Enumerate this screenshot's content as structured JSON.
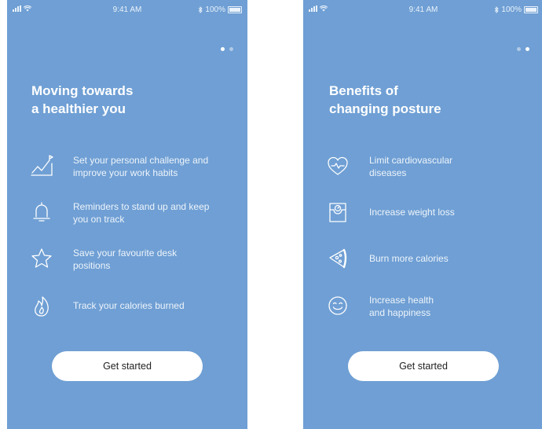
{
  "screens": [
    {
      "status": {
        "time": "9:41 AM",
        "battery": "100%"
      },
      "title_lines": [
        "Moving towards",
        "a healthier you"
      ],
      "features": [
        {
          "icon": "chart-trend-icon",
          "lines": [
            "Set your personal challenge and",
            "improve your work habits"
          ]
        },
        {
          "icon": "bell-icon",
          "lines": [
            "Reminders to stand up and keep",
            "you on track"
          ]
        },
        {
          "icon": "star-icon",
          "lines": [
            "Save your favourite desk",
            "positions"
          ]
        },
        {
          "icon": "flame-icon",
          "lines": [
            "Track your calories burned"
          ]
        }
      ],
      "cta_label": "Get started",
      "page_index": 1,
      "page_count": 2
    },
    {
      "status": {
        "time": "9:41 AM",
        "battery": "100%"
      },
      "title_lines": [
        "Benefits of",
        "changing posture"
      ],
      "features": [
        {
          "icon": "heart-pulse-icon",
          "lines": [
            "Limit cardiovascular",
            "diseases"
          ]
        },
        {
          "icon": "scale-icon",
          "lines": [
            "Increase weight loss"
          ]
        },
        {
          "icon": "pizza-slice-icon",
          "lines": [
            "Burn more calories"
          ]
        },
        {
          "icon": "smiley-icon",
          "lines": [
            "Increase health",
            "and happiness"
          ]
        }
      ],
      "cta_label": "Get started",
      "page_index": 2,
      "page_count": 2
    }
  ],
  "colors": {
    "background": "#6f9fd4",
    "text": "#ffffff",
    "button": "#ffffff",
    "button_text": "#222222"
  }
}
